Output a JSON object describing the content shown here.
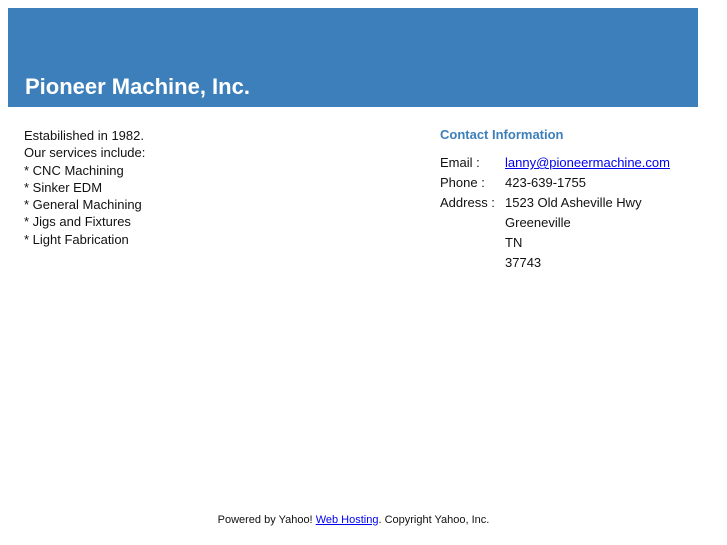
{
  "header": {
    "title": "Pioneer Machine, Inc.",
    "color": "#3d7fba"
  },
  "intro": {
    "lines": [
      "Estabilished in 1982.",
      "Our services include:",
      "* CNC Machining",
      "* Sinker EDM",
      "* General Machining",
      "* Jigs and Fixtures",
      "* Light Fabrication"
    ]
  },
  "contact": {
    "heading": "Contact Information",
    "email_label": "Email :",
    "email": "lanny@pioneermachine.com",
    "phone_label": "Phone :",
    "phone": "423-639-1755",
    "address_label": "Address :",
    "address": [
      "1523 Old Asheville Hwy",
      "Greeneville",
      "TN",
      "37743"
    ]
  },
  "footer": {
    "prefix": "Powered by Yahoo! ",
    "link": "Web Hosting",
    "suffix": ". Copyright Yahoo, Inc."
  }
}
